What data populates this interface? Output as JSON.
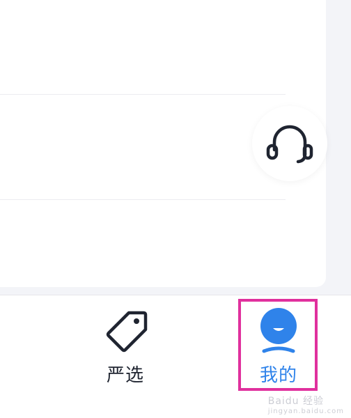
{
  "tabbar": {
    "tabs": [
      {
        "id": "strict",
        "label": "严选",
        "icon": "tag-icon",
        "active": false
      },
      {
        "id": "mine",
        "label": "我的",
        "icon": "user-icon",
        "active": true
      }
    ]
  },
  "floating": {
    "icon": "headset-icon"
  },
  "colors": {
    "active": "#2f83ea",
    "inactive": "#1f2430",
    "highlight": "#e0309d",
    "background": "#f3f4f8"
  },
  "watermark": {
    "text": "Baidu 经验",
    "subtext": "jingyan.baidu.com"
  }
}
